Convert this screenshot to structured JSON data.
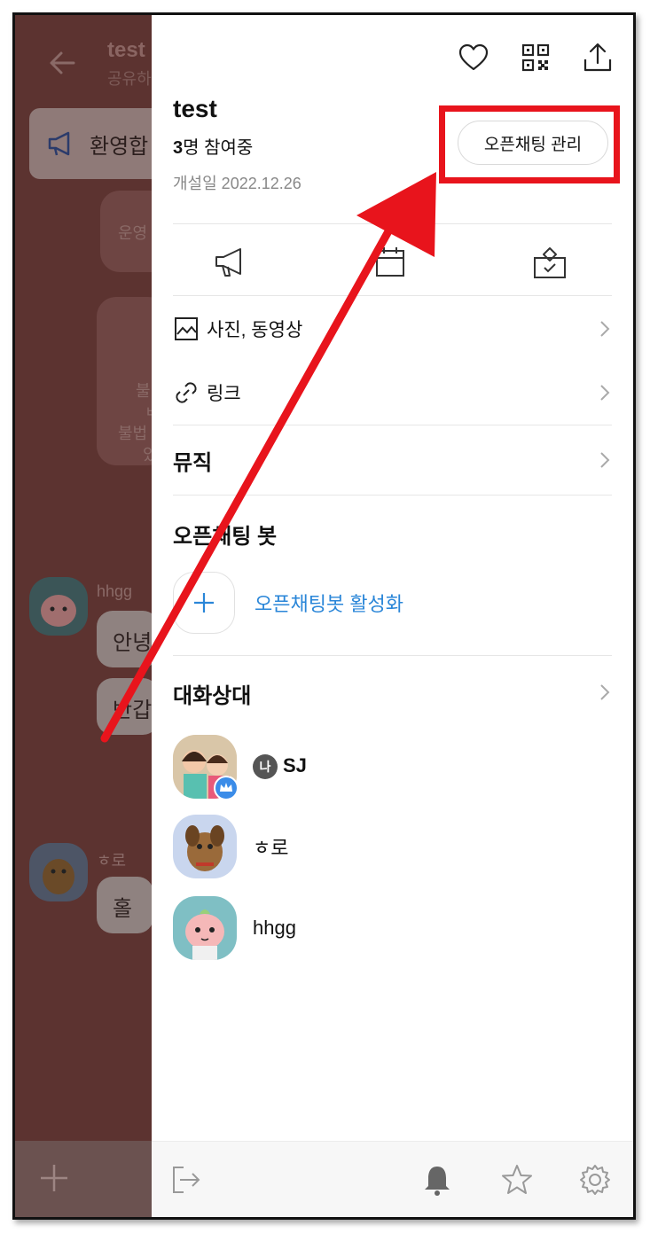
{
  "chat": {
    "title": "test",
    "subtitle": "공유하",
    "notice_text": "환영합",
    "dim_text_1": "운영",
    "dim_text_2": "불",
    "dim_text_3": "ㅂ",
    "dim_text_4": "불법",
    "dim_text_5": "있",
    "messages": [
      {
        "nick": "hhgg",
        "texts": [
          "안녕",
          "반갑"
        ]
      },
      {
        "nick": "ㅎ로",
        "texts": [
          "홀"
        ]
      }
    ]
  },
  "drawer": {
    "room_title": "test",
    "participants_count": "3",
    "participants_suffix": "명 참여중",
    "created_label": "개설일 2022.12.26",
    "manage_button": "오픈채팅 관리",
    "menu": {
      "photos": "사진, 동영상",
      "links": "링크",
      "music": "뮤직"
    },
    "bot_section": "오픈채팅 봇",
    "bot_activate": "오픈채팅봇 활성화",
    "members_section": "대화상대",
    "me_badge": "나",
    "members": [
      {
        "name": "SJ"
      },
      {
        "name": "ㅎ로"
      },
      {
        "name": "hhgg"
      }
    ]
  },
  "colors": {
    "highlight": "#e8141c",
    "link_blue": "#2a86d8",
    "dim_overlay": "#5c3330"
  },
  "icons": {
    "top": [
      "heart-icon",
      "qr-code-icon",
      "share-icon"
    ],
    "row": [
      "megaphone-icon",
      "calendar-icon",
      "vote-icon"
    ],
    "bottom": [
      "exit-icon",
      "bell-icon",
      "star-icon",
      "gear-icon"
    ]
  }
}
